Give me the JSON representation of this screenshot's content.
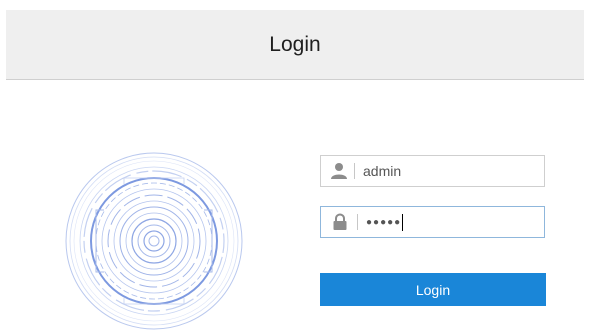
{
  "header": {
    "title": "Login"
  },
  "form": {
    "username_value": "admin",
    "password_value": "●●●●●",
    "login_label": "Login"
  },
  "colors": {
    "header_bg": "#efefef",
    "button_bg": "#1a86d8",
    "focus_border": "#8fb7dc"
  },
  "icons": {
    "username": "user-icon",
    "password": "lock-icon",
    "logo": "camera-lens-logo"
  }
}
